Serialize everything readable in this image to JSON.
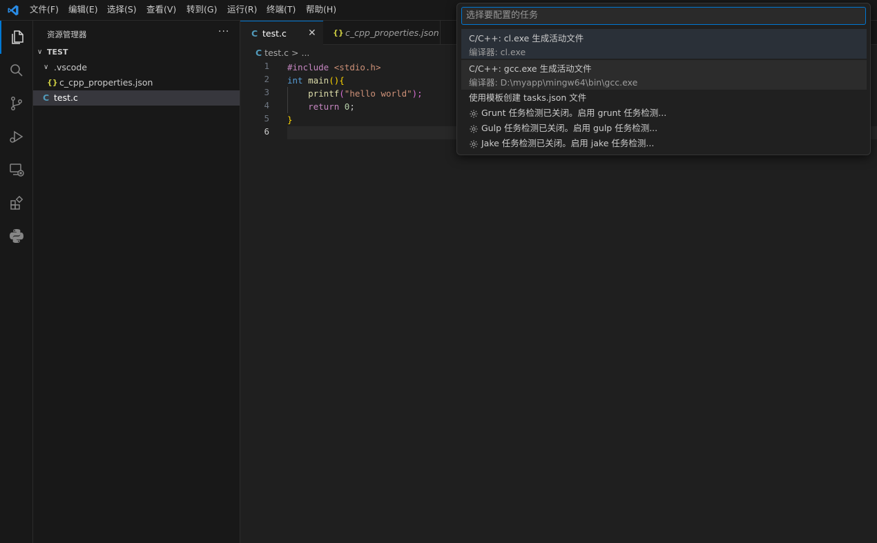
{
  "menubar": {
    "items": [
      "文件(F)",
      "编辑(E)",
      "选择(S)",
      "查看(V)",
      "转到(G)",
      "运行(R)",
      "终端(T)",
      "帮助(H)"
    ]
  },
  "sidebar": {
    "title": "资源管理器",
    "more": "···",
    "folder": "TEST",
    "subfolder": ".vscode",
    "files": [
      "c_cpp_properties.json",
      "test.c"
    ],
    "json_icon": "{}",
    "c_icon": "C"
  },
  "tabs": [
    {
      "label": "test.c",
      "icon": "C",
      "active": true
    },
    {
      "label": "c_cpp_properties.json",
      "icon": "{}",
      "active": false
    }
  ],
  "breadcrumb": {
    "file": "test.c",
    "sep": ">",
    "rest": "..."
  },
  "editor": {
    "line_numbers": [
      "1",
      "2",
      "3",
      "4",
      "5",
      "6"
    ],
    "line1": {
      "pre": "#include",
      "inc": "<stdio.h>"
    },
    "line2": {
      "kw": "int",
      "fn": "main",
      "br": "(){"
    },
    "line3": {
      "fn": "printf",
      "open": "(",
      "str": "\"hello world\"",
      "close": ");"
    },
    "line4": {
      "kw": "return",
      "num": "0",
      "end": ";"
    },
    "line5": {
      "br": "}"
    }
  },
  "quickpick": {
    "placeholder": "选择要配置的任务",
    "items": [
      {
        "title": "C/C++: cl.exe 生成活动文件",
        "sub": "编译器: cl.exe"
      },
      {
        "title": "C/C++: gcc.exe 生成活动文件",
        "sub": "编译器: D:\\myapp\\mingw64\\bin\\gcc.exe"
      }
    ],
    "template": "使用模板创建 tasks.json 文件",
    "detect": [
      "Grunt 任务检测已关闭。启用 grunt 任务检测...",
      "Gulp 任务检测已关闭。启用 gulp 任务检测...",
      "Jake 任务检测已关闭。启用 jake 任务检测..."
    ]
  },
  "colors": {
    "accent": "#0078d4",
    "c_icon": "#519aba",
    "json_icon": "#cbcb41"
  }
}
